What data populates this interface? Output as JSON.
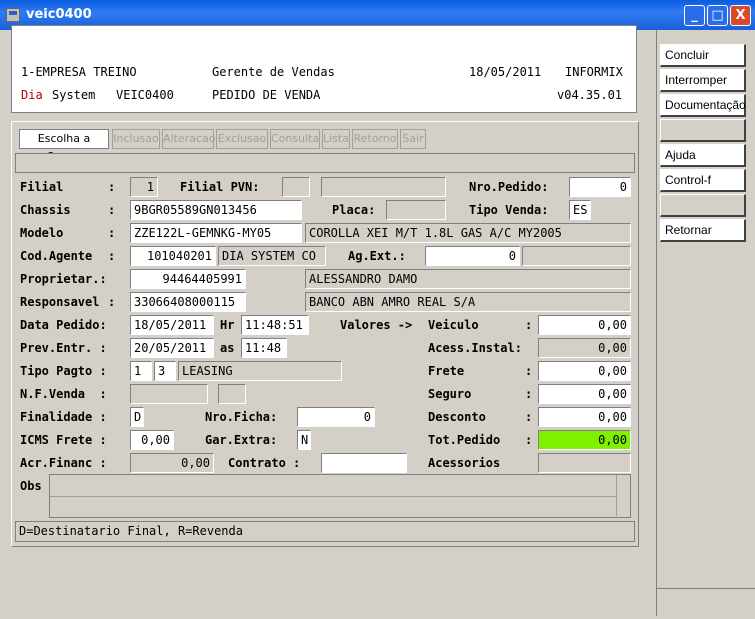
{
  "window": {
    "title": "veic0400",
    "minimize": "_",
    "maximize": "□",
    "close": "X"
  },
  "header": {
    "company": "1-EMPRESA TREINO",
    "role": "Gerente de Vendas",
    "date": "18/05/2011",
    "db": "INFORMIX",
    "dia": "Dia",
    "system_label": "System",
    "program": "VEIC0400",
    "screen": "PEDIDO DE VENDA",
    "version": "v04.35.01"
  },
  "tabs": [
    "Escolha a Opcao",
    "Inclusao",
    "Alteracao",
    "Exclusao",
    "Consulta",
    "Lista",
    "Retorno",
    "Sair"
  ],
  "form": {
    "filial_label": "Filial",
    "filial_value": "1",
    "filial_pvn_label": "Filial PVN:",
    "filial_pvn_value": "",
    "filial_pvn_desc": "",
    "nro_pedido_label": "Nro.Pedido:",
    "nro_pedido_value": "0",
    "chassis_label": "Chassis",
    "chassis_value": "9BGR05589GN013456",
    "placa_label": "Placa:",
    "placa_value": "",
    "tipo_venda_label": "Tipo Venda:",
    "tipo_venda_value": "ES",
    "modelo_label": "Modelo",
    "modelo_value": "ZZE122L-GEMNKG-MY05",
    "modelo_desc": "COROLLA XEI M/T 1.8L GAS A/C MY2005",
    "cod_agente_label": "Cod.Agente",
    "cod_agente_value": "101040201",
    "cod_agente_desc": "DIA SYSTEM CO",
    "ag_ext_label": "Ag.Ext.:",
    "ag_ext_value": "0",
    "ag_ext_desc": "",
    "proprietar_label": "Proprietar.:",
    "proprietar_value": "94464405991",
    "proprietar_desc": "ALESSANDRO DAMO",
    "responsavel_label": "Responsavel",
    "responsavel_value": "33066408000115",
    "responsavel_desc": "BANCO ABN AMRO REAL S/A",
    "data_pedido_label": "Data Pedido:",
    "data_pedido_value": "18/05/2011",
    "hr_label": "Hr",
    "hr_value": "11:48:51",
    "valores_label": "Valores ->",
    "prev_entr_label": "Prev.Entr. :",
    "prev_entr_value": "20/05/2011",
    "as_label": "as",
    "as_value": "11:48",
    "tipo_pagto_label": "Tipo Pagto :",
    "tipo_pagto_1": "1",
    "tipo_pagto_2": "3",
    "tipo_pagto_desc": "LEASING",
    "nf_venda_label": "N.F.Venda  :",
    "nf_venda_value": "",
    "nf_venda_serie": "",
    "finalidade_label": "Finalidade :",
    "finalidade_value": "D",
    "nro_ficha_label": "Nro.Ficha:",
    "nro_ficha_value": "0",
    "icms_frete_label": "ICMS Frete :",
    "icms_frete_value": "0,00",
    "gar_extra_label": "Gar.Extra:",
    "gar_extra_value": "N",
    "acr_financ_label": "Acr.Financ :",
    "acr_financ_value": "0,00",
    "contrato_label": "Contrato :",
    "contrato_value": "",
    "obs_label": "Obs"
  },
  "values": [
    {
      "label": "Veiculo",
      "value": "0,00"
    },
    {
      "label": "Acess.Instal:",
      "value": "0,00"
    },
    {
      "label": "Frete",
      "value": "0,00"
    },
    {
      "label": "Seguro",
      "value": "0,00"
    },
    {
      "label": "Desconto",
      "value": "0,00"
    },
    {
      "label": "Tot.Pedido",
      "value": "0,00"
    },
    {
      "label": "Acessorios",
      "value": ""
    }
  ],
  "hint": "D=Destinatario Final, R=Revenda",
  "side_buttons": [
    "Concluir",
    "Interromper",
    "Documentação",
    "",
    "Ajuda",
    "Control-f",
    "",
    "Retornar"
  ],
  "colors": {
    "title_bar": "#0a5ce0",
    "total_highlight": "#7ff000",
    "dia_red": "#c00000"
  }
}
